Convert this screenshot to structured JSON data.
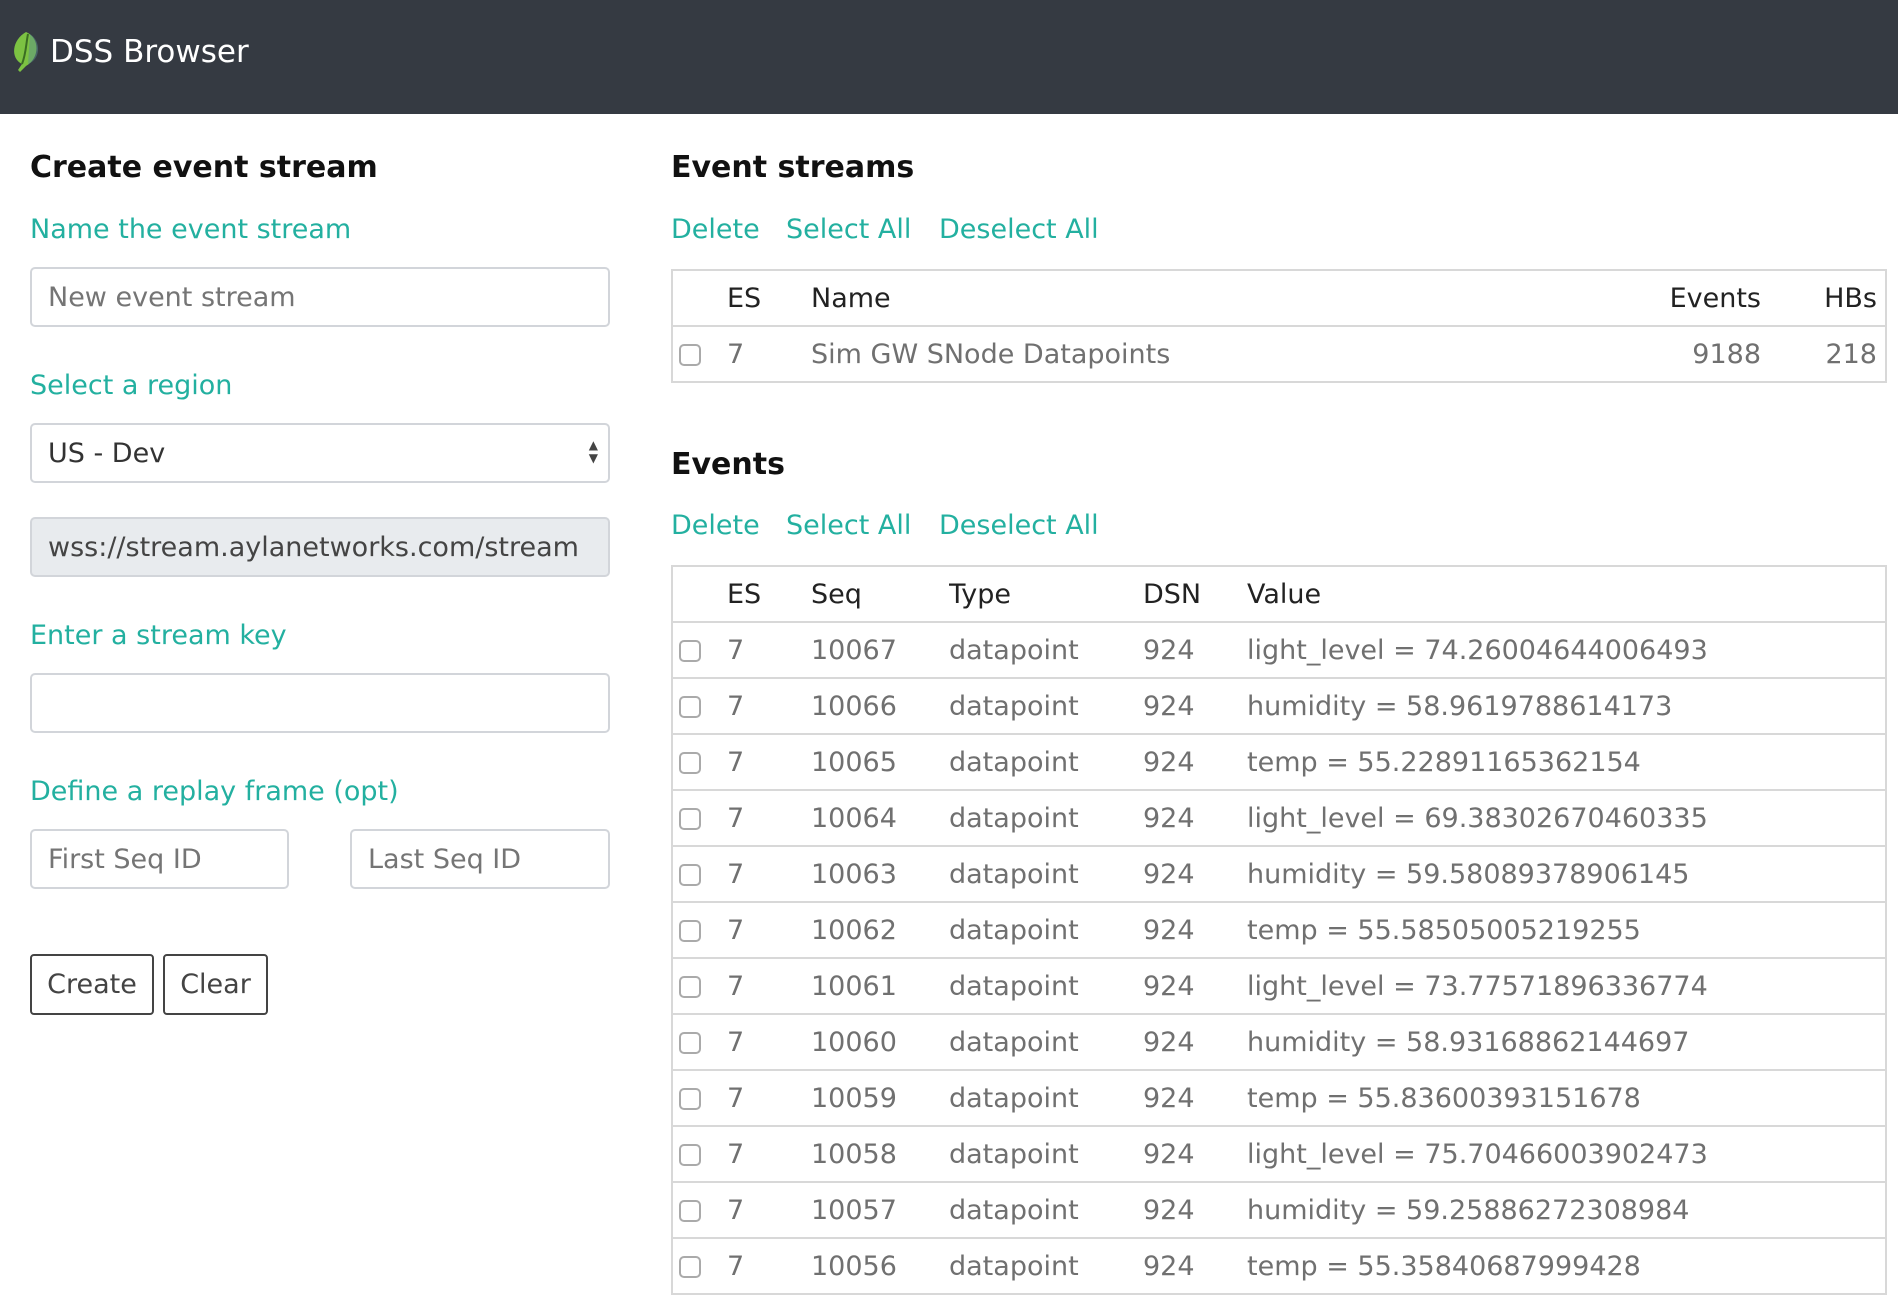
{
  "header": {
    "title": "DSS Browser"
  },
  "create": {
    "title": "Create event stream",
    "name_label": "Name the event stream",
    "name_placeholder": "New event stream",
    "region_label": "Select a region",
    "region_selected": "US - Dev",
    "url": "wss://stream.aylanetworks.com/stream",
    "key_label": "Enter a stream key",
    "key_value": "",
    "replay_label": "Define a replay frame (opt)",
    "first_placeholder": "First Seq ID",
    "last_placeholder": "Last Seq ID",
    "create_button": "Create",
    "clear_button": "Clear"
  },
  "streams": {
    "title": "Event streams",
    "actions": [
      "Delete",
      "Select All",
      "Deselect All"
    ],
    "columns": [
      "ES",
      "Name",
      "Events",
      "HBs"
    ],
    "rows": [
      {
        "es": "7",
        "name": "Sim GW SNode Datapoints",
        "events": "9188",
        "hbs": "218"
      }
    ]
  },
  "events": {
    "title": "Events",
    "actions": [
      "Delete",
      "Select All",
      "Deselect All"
    ],
    "columns": [
      "ES",
      "Seq",
      "Type",
      "DSN",
      "Value"
    ],
    "rows": [
      {
        "es": "7",
        "seq": "10067",
        "type": "datapoint",
        "dsn": "924",
        "value": "light_level = 74.26004644006493"
      },
      {
        "es": "7",
        "seq": "10066",
        "type": "datapoint",
        "dsn": "924",
        "value": "humidity = 58.9619788614173"
      },
      {
        "es": "7",
        "seq": "10065",
        "type": "datapoint",
        "dsn": "924",
        "value": "temp = 55.22891165362154"
      },
      {
        "es": "7",
        "seq": "10064",
        "type": "datapoint",
        "dsn": "924",
        "value": "light_level = 69.38302670460335"
      },
      {
        "es": "7",
        "seq": "10063",
        "type": "datapoint",
        "dsn": "924",
        "value": "humidity = 59.58089378906145"
      },
      {
        "es": "7",
        "seq": "10062",
        "type": "datapoint",
        "dsn": "924",
        "value": "temp = 55.58505005219255"
      },
      {
        "es": "7",
        "seq": "10061",
        "type": "datapoint",
        "dsn": "924",
        "value": "light_level = 73.77571896336774"
      },
      {
        "es": "7",
        "seq": "10060",
        "type": "datapoint",
        "dsn": "924",
        "value": "humidity = 58.93168862144697"
      },
      {
        "es": "7",
        "seq": "10059",
        "type": "datapoint",
        "dsn": "924",
        "value": "temp = 55.83600393151678"
      },
      {
        "es": "7",
        "seq": "10058",
        "type": "datapoint",
        "dsn": "924",
        "value": "light_level = 75.70466003902473"
      },
      {
        "es": "7",
        "seq": "10057",
        "type": "datapoint",
        "dsn": "924",
        "value": "humidity = 59.25886272308984"
      },
      {
        "es": "7",
        "seq": "10056",
        "type": "datapoint",
        "dsn": "924",
        "value": "temp = 55.35840687999428"
      }
    ]
  }
}
